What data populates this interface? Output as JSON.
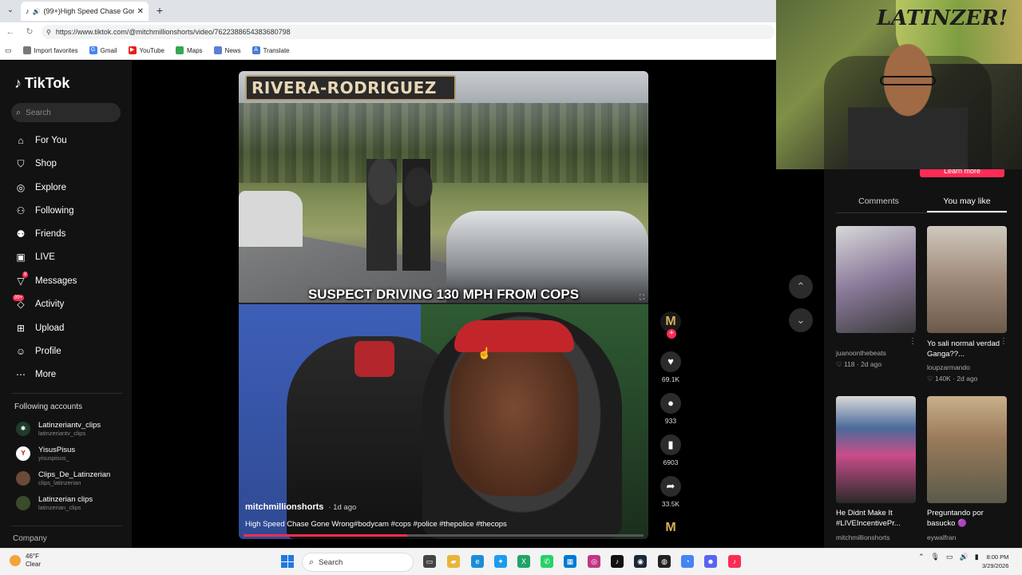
{
  "browser": {
    "tab_title": "(99+)High Speed Chase Gone",
    "url": "https://www.tiktok.com/@mitchmillionshorts/video/7622388654383680798",
    "bookmarks": [
      "Import favorites",
      "Gmail",
      "YouTube",
      "Maps",
      "News",
      "Translate"
    ]
  },
  "sidebar": {
    "logo": "TikTok",
    "search_placeholder": "Search",
    "nav": [
      {
        "label": "For You",
        "icon": "home-icon"
      },
      {
        "label": "Shop",
        "icon": "shop-icon"
      },
      {
        "label": "Explore",
        "icon": "compass-icon"
      },
      {
        "label": "Following",
        "icon": "following-icon"
      },
      {
        "label": "Friends",
        "icon": "friends-icon"
      },
      {
        "label": "LIVE",
        "icon": "live-icon"
      },
      {
        "label": "Messages",
        "icon": "messages-icon"
      },
      {
        "label": "Activity",
        "icon": "activity-icon",
        "badge": "99+"
      },
      {
        "label": "Upload",
        "icon": "upload-icon"
      },
      {
        "label": "Profile",
        "icon": "profile-icon"
      },
      {
        "label": "More",
        "icon": "more-icon"
      }
    ],
    "messages_badge": "8",
    "following_title": "Following accounts",
    "accounts": [
      {
        "name": "Latinzeriantv_clips",
        "handle": "latinzeriantv_clips"
      },
      {
        "name": "YisusPisus",
        "handle": "yisuspisus_"
      },
      {
        "name": "Clips_De_Latinzerian",
        "handle": "clips_latinzerian"
      },
      {
        "name": "Latinzerian clips",
        "handle": "latinzerian_clips"
      }
    ],
    "company": "Company"
  },
  "video": {
    "banner": "RIVERA-RODRIGUEZ",
    "caption_overlay": "SUSPECT DRIVING 130 MPH FROM COPS",
    "author": "mitchmillionshorts",
    "time": "· 1d ago",
    "description": "High Speed Chase Gone Wrong#bodycam #cops #police #thepolice #thecops",
    "progress": 0.41,
    "creator_initial": "M"
  },
  "actions": {
    "likes": "69.1K",
    "comments": "933",
    "saves": "6903",
    "shares": "33.5K"
  },
  "right_panel": {
    "learn_more": "Learn more",
    "tabs": [
      "Comments",
      "You may like"
    ],
    "recommendations": [
      {
        "title": "",
        "author": "juanoonthebeats",
        "likes": "118",
        "date": "2d ago"
      },
      {
        "title": "Yo sali normal verdad Ganga??...",
        "author": "loupzarmando",
        "likes": "140K",
        "date": "2d ago"
      },
      {
        "title": "He Didnt Make It #LIVEIncentivePr...",
        "author": "mitchmillionshorts",
        "likes": "",
        "date": ""
      },
      {
        "title": "Preguntando por basucko 🟣",
        "author": "eywalfran",
        "likes": "",
        "date": ""
      }
    ]
  },
  "webcam": {
    "graffiti": "LATINZER!"
  },
  "taskbar": {
    "temp": "46°F",
    "weather": "Clear",
    "search": "Search",
    "time": "8:00 PM",
    "date": "3/29/2026"
  },
  "colors": {
    "accent": "#fe2c55",
    "sidebar_bg": "#121212",
    "taskbar_bg": "#f3f3f3"
  }
}
